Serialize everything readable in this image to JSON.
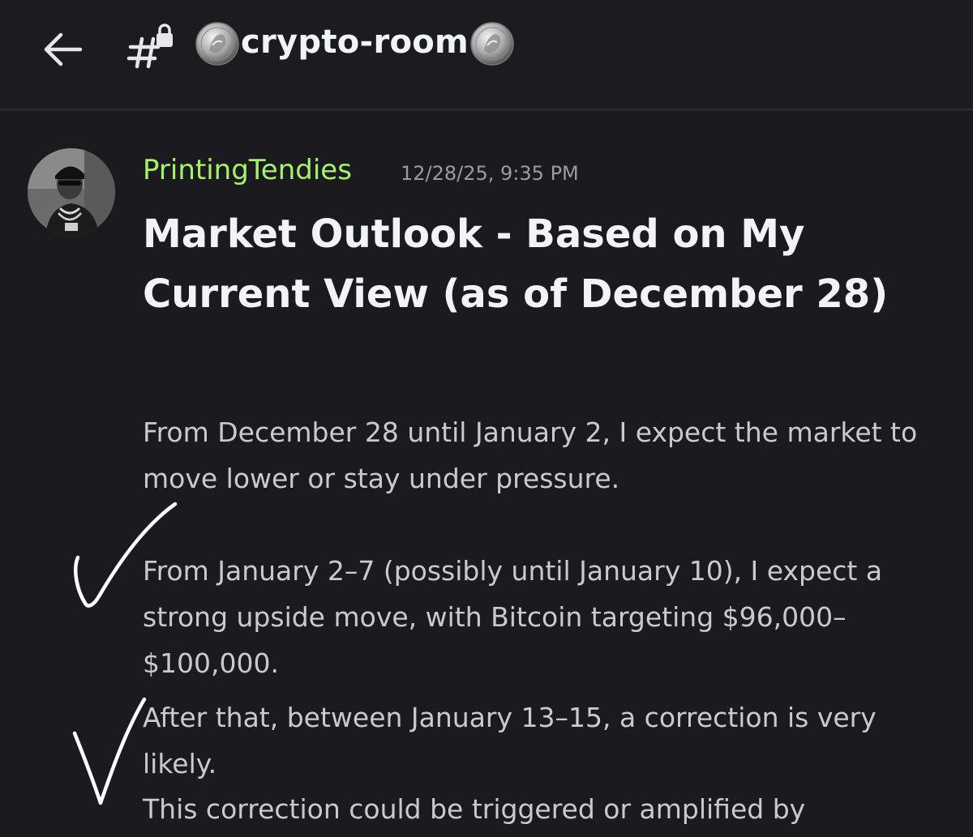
{
  "header": {
    "back_icon": "arrow-left-icon",
    "channel_icon": "locked-hashtag-icon",
    "channel_name": "crypto-room",
    "coin_icon": "silver-coin-icon"
  },
  "message": {
    "author": "PrintingTendies",
    "author_color": "#a6f16a",
    "timestamp": "12/28/25, 9:35 PM",
    "headline": "Market Outlook - Based on My Current View (as of December 28)",
    "paragraphs": [
      "From December 28 until January 2, I expect the market to move lower or stay under pressure.",
      "From January 2–7 (possibly until January 10), I expect a strong upside move, with Bitcoin targeting $96,000–$100,000.",
      "After that, between January 13–15, a correction is very likely.",
      "This correction could be triggered or amplified by"
    ]
  },
  "annotations": {
    "marks": [
      "handwritten-checkmark",
      "handwritten-checkmark"
    ],
    "mark_color": "#ffffff"
  }
}
